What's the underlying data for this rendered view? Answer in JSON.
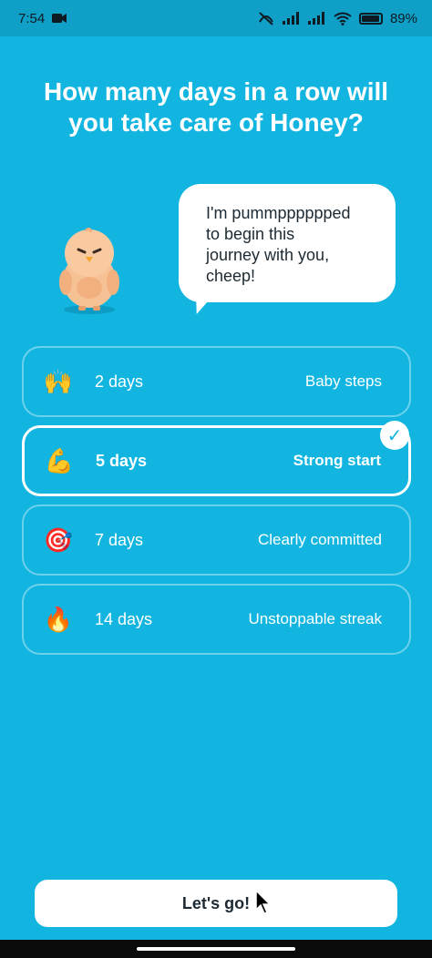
{
  "status_bar": {
    "time": "7:54",
    "battery_percent": "89%",
    "icons": [
      "video-camera-icon",
      "wifi-calling-off-icon",
      "signal-icon",
      "signal-icon",
      "wifi-icon",
      "battery-icon"
    ]
  },
  "title": "How many days in a row will you take care of Honey?",
  "speech": {
    "line1": "I'm pummpppppped",
    "line2": "to begin this",
    "line3": "journey with you,",
    "line4": "cheep!"
  },
  "options": [
    {
      "emoji": "🙌",
      "icon": "raised-hands-icon",
      "days": "2 days",
      "label": "Baby steps",
      "selected": false
    },
    {
      "emoji": "💪",
      "icon": "flexed-biceps-icon",
      "days": "5 days",
      "label": "Strong start",
      "selected": true
    },
    {
      "emoji": "🎯",
      "icon": "target-icon",
      "days": "7 days",
      "label": "Clearly committed",
      "selected": false
    },
    {
      "emoji": "🔥",
      "icon": "fire-icon",
      "days": "14 days",
      "label": "Unstoppable streak",
      "selected": false
    }
  ],
  "check_mark": "✓",
  "cta_label": "Let's go!",
  "colors": {
    "background": "#11b5e0",
    "status_bar": "#0f9fc7",
    "text_primary": "#ffffff",
    "text_dark": "#1d2a33",
    "mascot_body": "#f7c196"
  }
}
